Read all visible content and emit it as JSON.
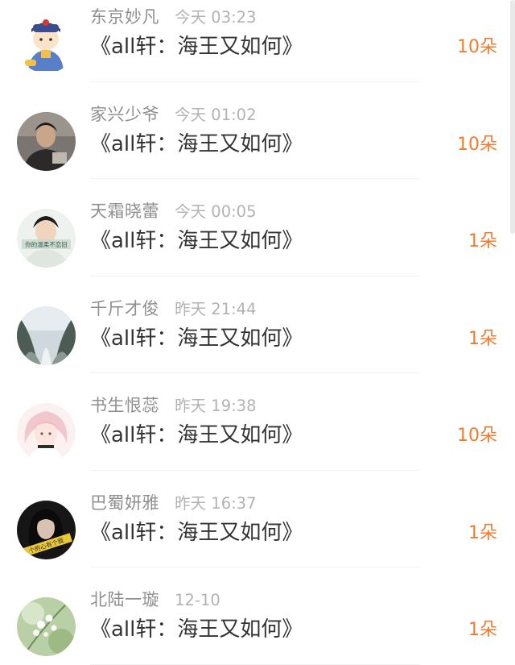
{
  "list": {
    "items": [
      {
        "name": "东京妙凡",
        "time": "今天 03:23",
        "title": "《all轩：海王又如何》",
        "count": "10朵",
        "avatar_icon": "cartoon-prince-avatar-icon"
      },
      {
        "name": "家兴少爷",
        "time": "今天 01:02",
        "title": "《all轩：海王又如何》",
        "count": "10朵",
        "avatar_icon": "portrait-photo-avatar-icon"
      },
      {
        "name": "天霜晓蕾",
        "time": "今天 00:05",
        "title": "《all轩：海王又如何》",
        "count": "1朵",
        "avatar_icon": "portrait-with-caption-avatar-icon",
        "avatar_caption": "你的温柔不恋旧"
      },
      {
        "name": "千斤才俊",
        "time": "昨天 21:44",
        "title": "《all轩：海王又如何》",
        "count": "1朵",
        "avatar_icon": "snowy-forest-avatar-icon"
      },
      {
        "name": "书生恨蕊",
        "time": "昨天 19:38",
        "title": "《all轩：海王又如何》",
        "count": "10朵",
        "avatar_icon": "anime-girl-avatar-icon"
      },
      {
        "name": "巴蜀妍雅",
        "time": "昨天 16:37",
        "title": "《all轩：海王又如何》",
        "count": "1朵",
        "avatar_icon": "dark-portrait-avatar-icon",
        "avatar_caption": "个的心有个我"
      },
      {
        "name": "北陆一璇",
        "time": "12-10",
        "title": "《all轩：海王又如何》",
        "count": "1朵",
        "avatar_icon": "white-flowers-avatar-icon"
      }
    ]
  },
  "colors": {
    "name": "#8f8f8f",
    "time": "#b3b3b3",
    "title": "#333333",
    "count_accent": "#ef7b2d",
    "divider": "#f3f3f3"
  }
}
